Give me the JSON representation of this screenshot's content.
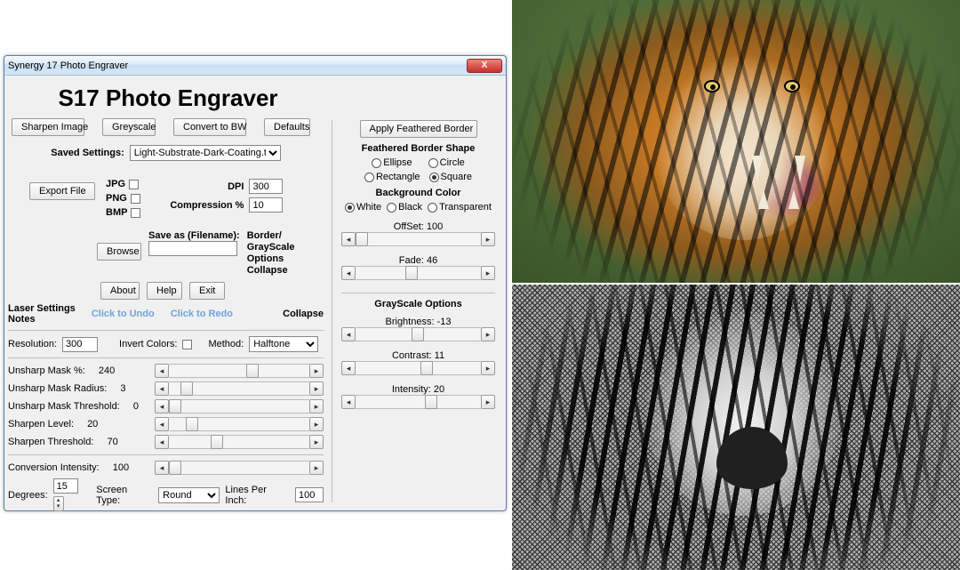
{
  "window": {
    "title": "Synergy 17 Photo Engraver",
    "heading": "S17 Photo Engraver",
    "close_x": "X"
  },
  "toolbar": {
    "sharpen": "Sharpen Image",
    "greyscale": "Greyscale",
    "convert_bw": "Convert to BW",
    "defaults": "Defaults"
  },
  "saved": {
    "label": "Saved Settings:",
    "value": "Light-Substrate-Dark-Coating.txt"
  },
  "export": {
    "button": "Export File",
    "jpg": "JPG",
    "png": "PNG",
    "bmp": "BMP",
    "dpi_label": "DPI",
    "dpi_value": "300",
    "comp_label": "Compression %",
    "comp_value": "10"
  },
  "file": {
    "browse": "Browse",
    "saveas_label": "Save as (Filename):",
    "saveas_value": ""
  },
  "border_collapse": {
    "line1": "Border/",
    "line2": "GrayScale",
    "line3": "Options",
    "line4": "Collapse"
  },
  "mini": {
    "about": "About",
    "help": "Help",
    "exit": "Exit"
  },
  "undo": {
    "laser": "Laser Settings",
    "notes": "Notes",
    "undo": "Click to Undo",
    "redo": "Click to Redo",
    "collapse": "Collapse"
  },
  "res": {
    "label": "Resolution:",
    "value": "300",
    "invert_label": "Invert Colors:",
    "method_label": "Method:",
    "method_value": "Halftone"
  },
  "sliders": {
    "um_pct_label": "Unsharp Mask %:",
    "um_pct_value": "240",
    "um_rad_label": "Unsharp Mask Radius:",
    "um_rad_value": "3",
    "um_thr_label": "Unsharp Mask Threshold:",
    "um_thr_value": "0",
    "sh_lvl_label": "Sharpen Level:",
    "sh_lvl_value": "20",
    "sh_thr_label": "Sharpen Threshold:",
    "sh_thr_value": "70",
    "conv_label": "Conversion Intensity:",
    "conv_value": "100",
    "deg_label": "Degrees:",
    "deg_value": "15",
    "screen_label": "Screen Type:",
    "screen_value": "Round",
    "lpi_label": "Lines Per Inch:",
    "lpi_value": "100"
  },
  "feather": {
    "apply": "Apply Feathered Border",
    "heading": "Feathered Border Shape",
    "ellipse": "Ellipse",
    "circle": "Circle",
    "rectangle": "Rectangle",
    "square": "Square",
    "bg_heading": "Background Color",
    "white": "White",
    "black": "Black",
    "transparent": "Transparent",
    "offset_label": "OffSet:",
    "offset_value": "100",
    "fade_label": "Fade:",
    "fade_value": "46"
  },
  "gs": {
    "heading": "GrayScale Options",
    "bright_label": "Brightness:",
    "bright_value": "-13",
    "contrast_label": "Contrast:",
    "contrast_value": "11",
    "intensity_label": "Intensity:",
    "intensity_value": "20"
  },
  "glyph": {
    "left": "◂",
    "right": "▸",
    "updown": "▴▾"
  }
}
